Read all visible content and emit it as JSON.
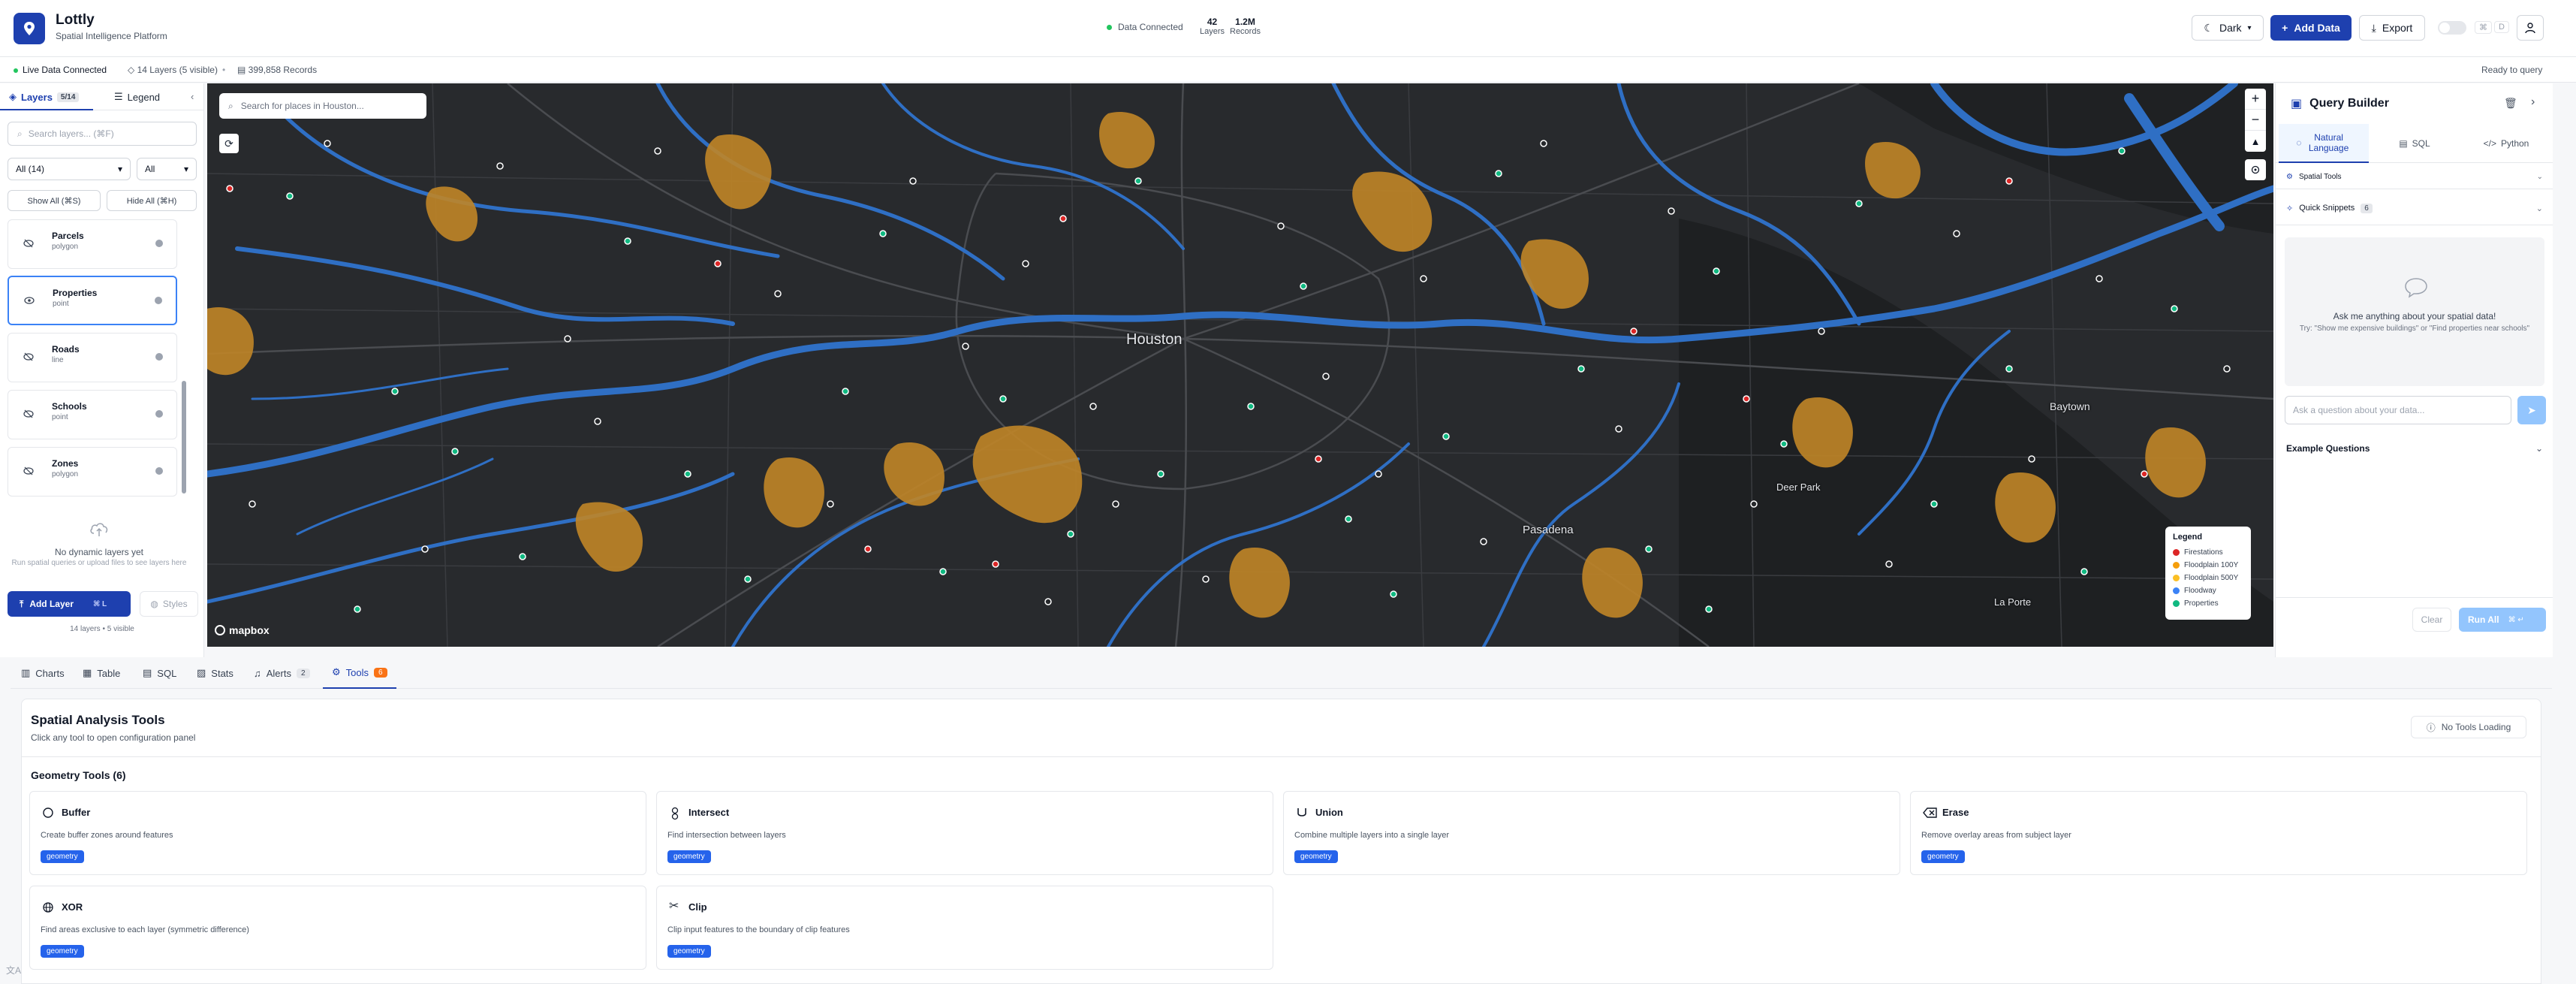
{
  "app": {
    "title": "Lottly",
    "subtitle": "Spatial Intelligence Platform"
  },
  "header": {
    "connection": "Data Connected",
    "stats": [
      {
        "value": "42",
        "label": "Layers"
      },
      {
        "value": "1.2M",
        "label": "Records"
      }
    ],
    "theme_label": "Dark",
    "add_data_label": "Add Data",
    "export_label": "Export",
    "kbd_1": "⌘",
    "kbd_2": "D"
  },
  "subbar": {
    "live": "Live Data Connected",
    "layers": "14 Layers (5 visible)",
    "records": "399,858 Records",
    "status": "Ready to query"
  },
  "sidebar": {
    "tab_layers": "Layers",
    "tab_layers_badge": "5/14",
    "tab_legend": "Legend",
    "search_placeholder": "Search layers... (⌘F)",
    "filter_all": "All (14)",
    "filter_type": "All",
    "show_all": "Show All (⌘S)",
    "hide_all": "Hide All (⌘H)",
    "layers": [
      {
        "name": "Parcels",
        "type": "polygon"
      },
      {
        "name": "Properties",
        "type": "point"
      },
      {
        "name": "Roads",
        "type": "line"
      },
      {
        "name": "Schools",
        "type": "point"
      },
      {
        "name": "Zones",
        "type": "polygon"
      }
    ],
    "empty_title": "No dynamic layers yet",
    "empty_sub": "Run spatial queries or upload files to see layers here",
    "add_layer": "Add Layer",
    "add_layer_kbd": "⌘ L",
    "styles": "Styles",
    "count": "14 layers • 5 visible"
  },
  "map": {
    "search_placeholder": "Search for places in Houston...",
    "cities": [
      {
        "name": "Houston"
      },
      {
        "name": "Pasadena"
      },
      {
        "name": "Baytown"
      },
      {
        "name": "Deer Park"
      },
      {
        "name": "La Porte"
      }
    ],
    "attribution": "mapbox",
    "legend": {
      "title": "Legend",
      "items": [
        {
          "label": "Firestations",
          "color": "#dc2626"
        },
        {
          "label": "Floodplain 100Y",
          "color": "#f59e0b"
        },
        {
          "label": "Floodplain 500Y",
          "color": "#fbbf24"
        },
        {
          "label": "Floodway",
          "color": "#3b82f6"
        },
        {
          "label": "Properties",
          "color": "#10b981"
        }
      ]
    }
  },
  "query_builder": {
    "title": "Query Builder",
    "tabs": [
      "Natural Language",
      "SQL",
      "Python"
    ],
    "spatial_tools": "Spatial Tools",
    "quick_snippets": "Quick Snippets",
    "snippets_count": "6",
    "empty_title": "Ask me anything about your spatial data!",
    "empty_sub": "Try: \"Show me expensive buildings\" or \"Find properties near schools\"",
    "input_placeholder": "Ask a question about your data...",
    "example_questions": "Example Questions",
    "clear": "Clear",
    "run_all": "Run All",
    "run_kbd": "⌘ ↵"
  },
  "bottom_tabs": [
    {
      "label": "Charts"
    },
    {
      "label": "Table"
    },
    {
      "label": "SQL"
    },
    {
      "label": "Stats"
    },
    {
      "label": "Alerts",
      "count": "2"
    },
    {
      "label": "Tools",
      "count": "6"
    }
  ],
  "tools_panel": {
    "title": "Spatial Analysis Tools",
    "subtitle": "Click any tool to open configuration panel",
    "loading": "No Tools Loading",
    "group_title": "Geometry Tools (6)",
    "tools": [
      {
        "name": "Buffer",
        "desc": "Create buffer zones around features",
        "tag": "geometry",
        "icon": "circle-icon"
      },
      {
        "name": "Intersect",
        "desc": "Find intersection between layers",
        "tag": "geometry",
        "icon": "intersect-icon"
      },
      {
        "name": "Union",
        "desc": "Combine multiple layers into a single layer",
        "tag": "geometry",
        "icon": "union-icon"
      },
      {
        "name": "Erase",
        "desc": "Remove overlay areas from subject layer",
        "tag": "geometry",
        "icon": "eraser-icon"
      },
      {
        "name": "XOR",
        "desc": "Find areas exclusive to each layer (symmetric difference)",
        "tag": "geometry",
        "icon": "globe-icon"
      },
      {
        "name": "Clip",
        "desc": "Clip input features to the boundary of clip features",
        "tag": "geometry",
        "icon": "scissors-icon"
      }
    ]
  }
}
